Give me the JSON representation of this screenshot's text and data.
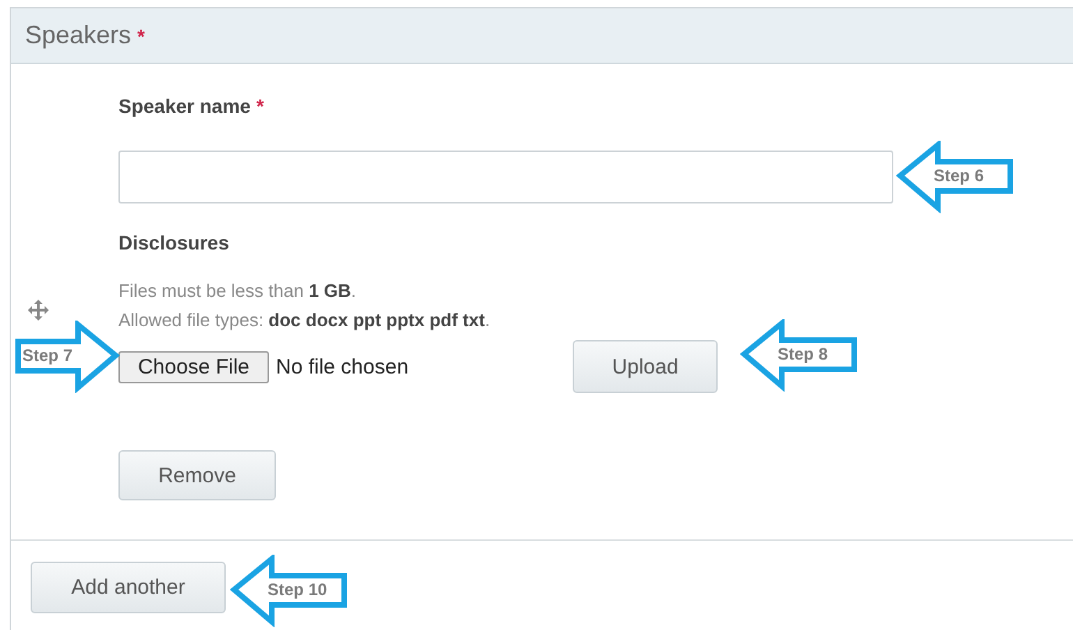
{
  "section": {
    "title": "Speakers",
    "required_mark": "*"
  },
  "speaker_name": {
    "label": "Speaker name",
    "required_mark": "*",
    "callout": {
      "label": "Step 6",
      "kind": "left"
    }
  },
  "disclosures": {
    "label": "Disclosures",
    "help": [
      "Files must be less than **1 GB**.",
      "Allowed file types: **doc docx ppt pptx pdf txt**."
    ],
    "choose_button": {
      "label": "Choose File",
      "callout": {
        "label": "Step 7",
        "kind": "right"
      }
    },
    "file_status": "No file chosen",
    "upload_button": {
      "label": "Upload",
      "callout": {
        "label": "Step 8",
        "kind": "left"
      }
    },
    "remove_button": {
      "label": "Remove"
    }
  },
  "add_button": {
    "label": "Add another",
    "callout": {
      "label": "Step 10",
      "kind": "left"
    }
  }
}
